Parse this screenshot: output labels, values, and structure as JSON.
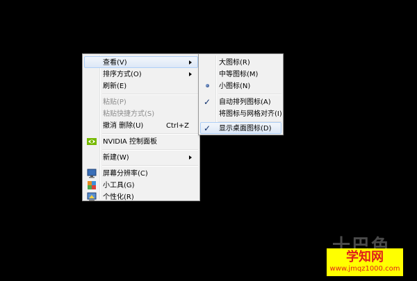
{
  "main_menu": {
    "items": [
      {
        "label": "查看(V)"
      },
      {
        "label": "排序方式(O)"
      },
      {
        "label": "刷新(E)"
      },
      {
        "label": "粘贴(P)"
      },
      {
        "label": "粘贴快捷方式(S)"
      },
      {
        "label": "撤消 删除(U)",
        "shortcut": "Ctrl+Z"
      },
      {
        "label": "NVIDIA 控制面板"
      },
      {
        "label": "新建(W)"
      },
      {
        "label": "屏幕分辨率(C)"
      },
      {
        "label": "小工具(G)"
      },
      {
        "label": "个性化(R)"
      }
    ]
  },
  "view_submenu": {
    "items": [
      {
        "label": "大图标(R)"
      },
      {
        "label": "中等图标(M)"
      },
      {
        "label": "小图标(N)",
        "selected": true
      },
      {
        "label": "自动排列图标(A)",
        "checked": true
      },
      {
        "label": "将图标与网格对齐(I)"
      },
      {
        "label": "显示桌面图标(D)",
        "checked": true
      }
    ]
  },
  "watermark": {
    "top": "十巴色",
    "title": "学知网",
    "url": "www.jmqz1000.com"
  },
  "colors": {
    "menu_bg": "#f1f1f1",
    "highlight": "#dde8f7",
    "watermark_bg": "#ffff00",
    "watermark_text": "#e0201a"
  }
}
